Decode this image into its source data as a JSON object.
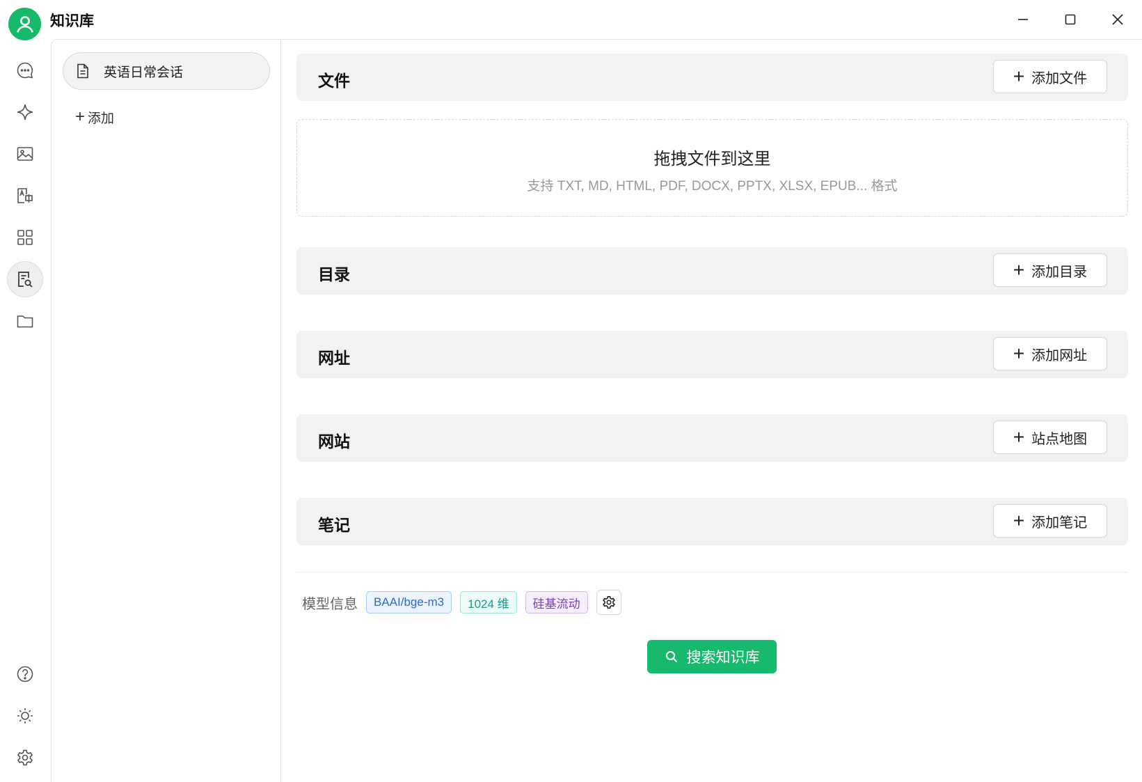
{
  "app": {
    "title": "知识库",
    "accent": "#16b86a"
  },
  "window_controls": {
    "minimize_icon": "minimize-icon",
    "maximize_icon": "maximize-icon",
    "close_icon": "close-icon"
  },
  "rail": {
    "top_items": [
      {
        "icon": "chat-icon"
      },
      {
        "icon": "sparkle-icon"
      },
      {
        "icon": "image-icon"
      },
      {
        "icon": "translate-icon"
      },
      {
        "icon": "apps-grid-icon"
      },
      {
        "icon": "knowledge-base-icon",
        "active": true
      },
      {
        "icon": "folder-icon"
      }
    ],
    "bottom_items": [
      {
        "icon": "help-icon"
      },
      {
        "icon": "theme-sun-icon"
      },
      {
        "icon": "settings-gear-icon"
      }
    ]
  },
  "kb_list": {
    "items": [
      {
        "label": "英语日常会话",
        "icon": "document-icon",
        "selected": true
      }
    ],
    "add_label": "添加"
  },
  "sections": {
    "files": {
      "title": "文件",
      "button": "添加文件"
    },
    "directory": {
      "title": "目录",
      "button": "添加目录"
    },
    "url": {
      "title": "网址",
      "button": "添加网址"
    },
    "website": {
      "title": "网站",
      "button": "站点地图"
    },
    "notes": {
      "title": "笔记",
      "button": "添加笔记"
    }
  },
  "dropzone": {
    "title": "拖拽文件到这里",
    "hint": "支持 TXT, MD, HTML, PDF, DOCX, PPTX, XLSX, EPUB... 格式"
  },
  "model_info": {
    "label": "模型信息",
    "model": "BAAI/bge-m3",
    "dimensions": "1024 维",
    "provider": "硅基流动"
  },
  "search_button": "搜索知识库"
}
